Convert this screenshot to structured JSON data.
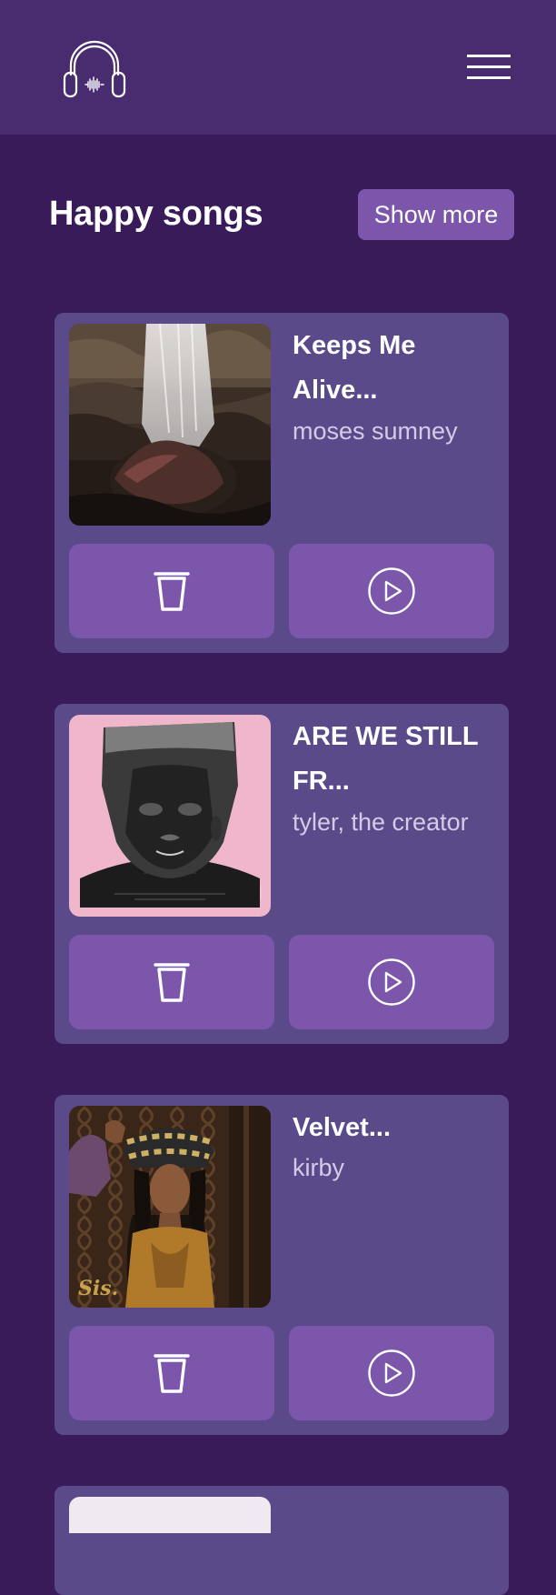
{
  "app": {
    "logo_icon": "headphones-icon",
    "menu_icon": "hamburger-menu-icon"
  },
  "section": {
    "title": "Happy songs",
    "show_more_label": "Show more"
  },
  "songs": [
    {
      "title": "Keeps Me Alive...",
      "artist": "moses sumney",
      "cover": "waterfall-album-cover"
    },
    {
      "title": "ARE WE STILL FR...",
      "artist": "tyler, the creator",
      "cover": "portrait-album-cover"
    },
    {
      "title": "Velvet...",
      "artist": "kirby",
      "cover": "sis-album-cover"
    }
  ],
  "actions": {
    "delete_icon": "trash-icon",
    "play_icon": "play-circle-icon"
  },
  "colors": {
    "background": "#381b58",
    "header": "#492c6f",
    "card": "#5a4a8a",
    "button": "#7b56aa",
    "text": "#ffffff",
    "muted_text": "#d4cce6"
  }
}
